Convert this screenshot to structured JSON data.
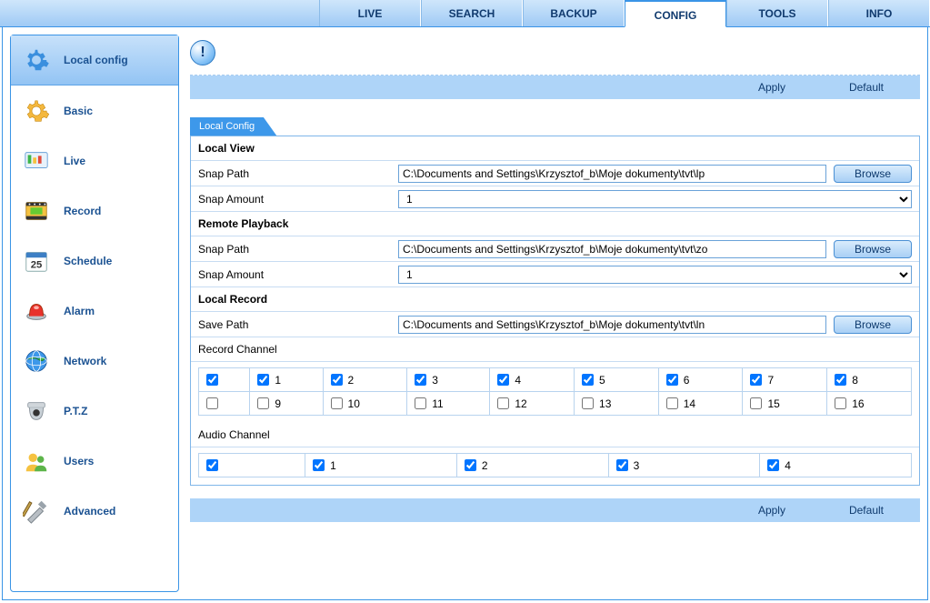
{
  "topnav": {
    "items": [
      {
        "label": "LIVE"
      },
      {
        "label": "SEARCH"
      },
      {
        "label": "BACKUP"
      },
      {
        "label": "CONFIG"
      },
      {
        "label": "TOOLS"
      },
      {
        "label": "INFO"
      }
    ],
    "active": "CONFIG"
  },
  "sidebar": {
    "items": [
      {
        "label": "Local config",
        "key": "local-config"
      },
      {
        "label": "Basic",
        "key": "basic"
      },
      {
        "label": "Live",
        "key": "live"
      },
      {
        "label": "Record",
        "key": "record"
      },
      {
        "label": "Schedule",
        "key": "schedule"
      },
      {
        "label": "Alarm",
        "key": "alarm"
      },
      {
        "label": "Network",
        "key": "network"
      },
      {
        "label": "P.T.Z",
        "key": "ptz"
      },
      {
        "label": "Users",
        "key": "users"
      },
      {
        "label": "Advanced",
        "key": "advanced"
      }
    ],
    "active": "local-config"
  },
  "actions": {
    "apply": "Apply",
    "default": "Default"
  },
  "tab": {
    "label": "Local Config"
  },
  "sections": {
    "localView": {
      "title": "Local View",
      "snapPathLabel": "Snap Path",
      "snapPath": "C:\\Documents and Settings\\Krzysztof_b\\Moje dokumenty\\tvt\\lp",
      "snapAmountLabel": "Snap Amount",
      "snapAmount": "1",
      "browse": "Browse"
    },
    "remotePlayback": {
      "title": "Remote Playback",
      "snapPathLabel": "Snap Path",
      "snapPath": "C:\\Documents and Settings\\Krzysztof_b\\Moje dokumenty\\tvt\\zo",
      "snapAmountLabel": "Snap Amount",
      "snapAmount": "1",
      "browse": "Browse"
    },
    "localRecord": {
      "title": "Local Record",
      "savePathLabel": "Save Path",
      "savePath": "C:\\Documents and Settings\\Krzysztof_b\\Moje dokumenty\\tvt\\ln",
      "browse": "Browse",
      "recordChannelLabel": "Record Channel",
      "audioChannelLabel": "Audio Channel"
    }
  },
  "recordChannels": [
    {
      "n": "1",
      "checked": true
    },
    {
      "n": "2",
      "checked": true
    },
    {
      "n": "3",
      "checked": true
    },
    {
      "n": "4",
      "checked": true
    },
    {
      "n": "5",
      "checked": true
    },
    {
      "n": "6",
      "checked": true
    },
    {
      "n": "7",
      "checked": true
    },
    {
      "n": "8",
      "checked": true
    },
    {
      "n": "9",
      "checked": false
    },
    {
      "n": "10",
      "checked": false
    },
    {
      "n": "11",
      "checked": false
    },
    {
      "n": "12",
      "checked": false
    },
    {
      "n": "13",
      "checked": false
    },
    {
      "n": "14",
      "checked": false
    },
    {
      "n": "15",
      "checked": false
    },
    {
      "n": "16",
      "checked": false
    }
  ],
  "recordMaster": {
    "row1": true,
    "row2": false
  },
  "audioChannels": [
    {
      "n": "1",
      "checked": true
    },
    {
      "n": "2",
      "checked": true
    },
    {
      "n": "3",
      "checked": true
    },
    {
      "n": "4",
      "checked": true
    }
  ],
  "audioMaster": true
}
